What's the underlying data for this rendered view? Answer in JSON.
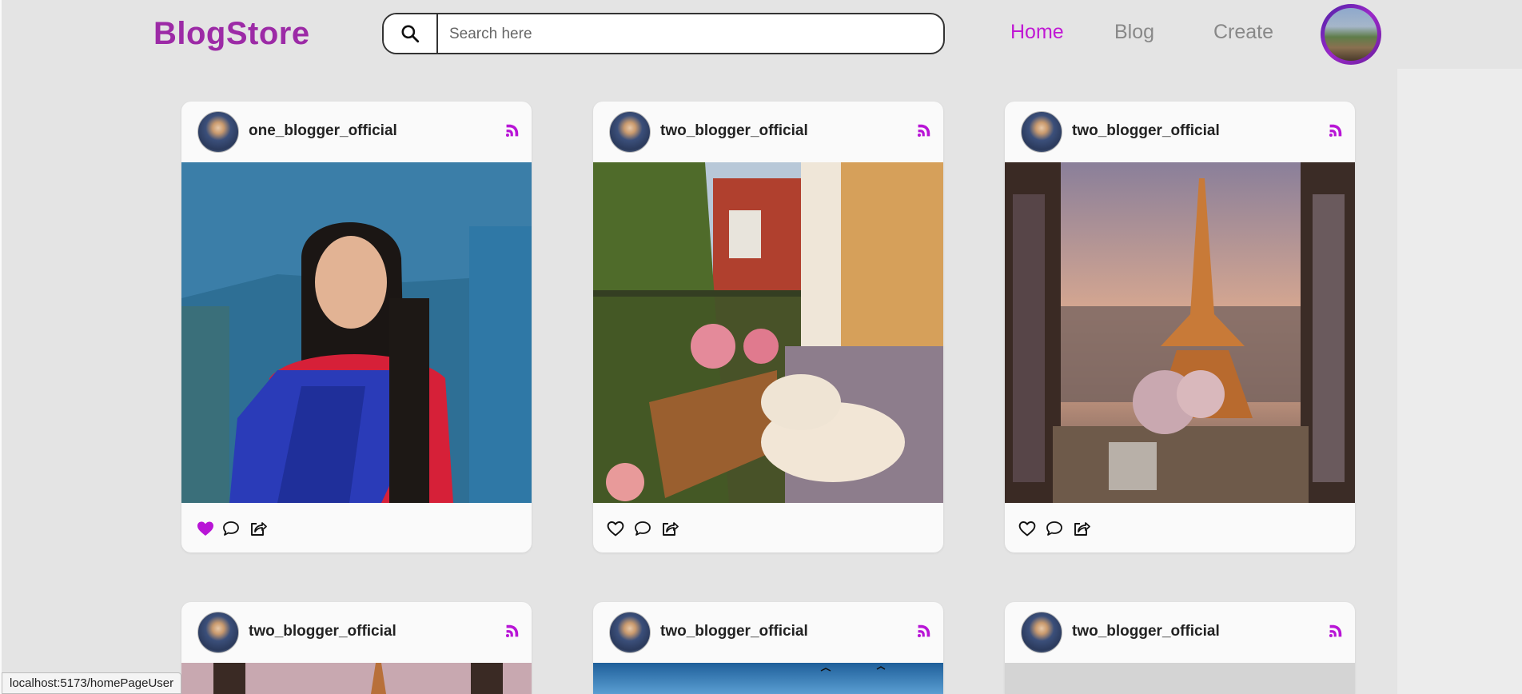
{
  "app": {
    "logo": "BlogStore"
  },
  "search": {
    "placeholder": "Search here"
  },
  "nav": {
    "home": "Home",
    "blog": "Blog",
    "create": "Create"
  },
  "posts": [
    {
      "username": "one_blogger_official",
      "liked": true
    },
    {
      "username": "two_blogger_official",
      "liked": false
    },
    {
      "username": "two_blogger_official",
      "liked": false
    },
    {
      "username": "two_blogger_official",
      "liked": false
    },
    {
      "username": "two_blogger_official",
      "liked": false
    },
    {
      "username": "two_blogger_official",
      "liked": false
    }
  ],
  "colors": {
    "brand": "#9c2aa6",
    "nav_active": "#c018d4",
    "like": "#b815d6"
  },
  "status": {
    "url": "localhost:5173/homePageUser"
  }
}
